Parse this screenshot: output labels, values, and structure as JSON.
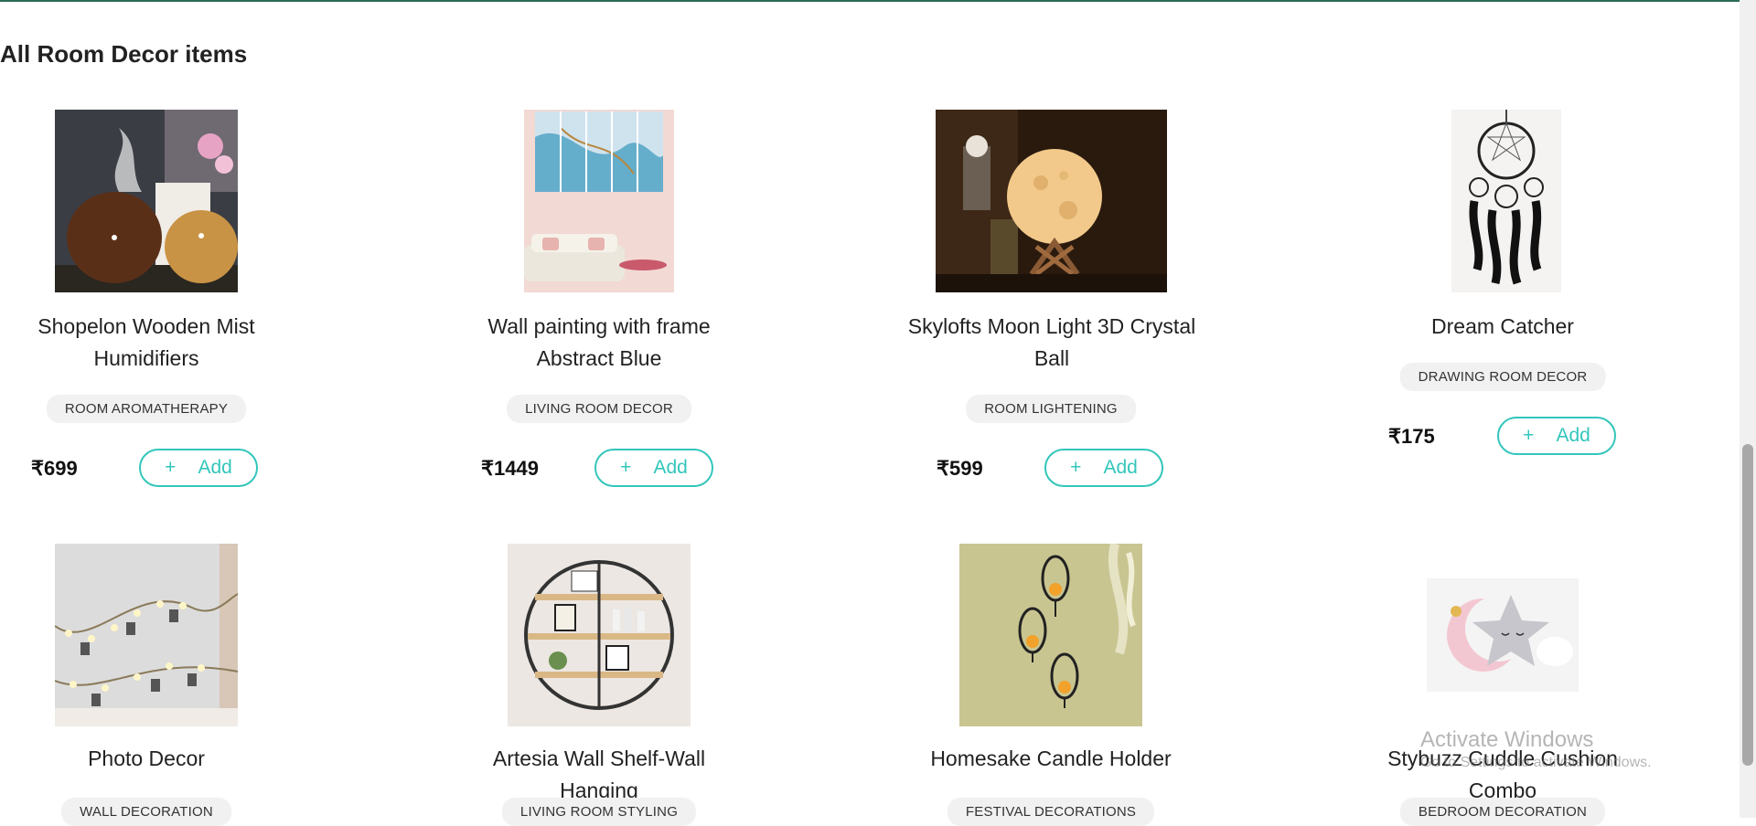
{
  "page": {
    "heading": "All Room Decor items"
  },
  "products": [
    {
      "title": "Shopelon Wooden Mist Humidifiers",
      "title_line1": "Shopelon Wooden Mist",
      "title_line2": "Humidifiers",
      "category": "ROOM AROMATHERAPY",
      "price": "₹699",
      "add_label": "Add",
      "image_icon": "humidifier-image"
    },
    {
      "title": "Wall painting with frame Abstract Blue",
      "title_line1": "Wall painting with frame",
      "title_line2": "Abstract Blue",
      "category": "LIVING ROOM DECOR",
      "price": "₹1449",
      "add_label": "Add",
      "image_icon": "wall-painting-image"
    },
    {
      "title": "Skylofts Moon Light 3D Crystal Ball",
      "title_line1": "Skylofts Moon Light 3D Crystal",
      "title_line2": "Ball",
      "category": "ROOM LIGHTENING",
      "price": "₹599",
      "add_label": "Add",
      "image_icon": "moon-lamp-image"
    },
    {
      "title": "Dream Catcher",
      "title_line1": "Dream Catcher",
      "title_line2": "",
      "category": "DRAWING ROOM DECOR",
      "price": "₹175",
      "add_label": "Add",
      "image_icon": "dream-catcher-image"
    },
    {
      "title": "Photo Decor",
      "category": "WALL DECORATION",
      "image_icon": "photo-lights-image"
    },
    {
      "title": "Artesia Wall Shelf-Wall Hanging",
      "category": "LIVING ROOM STYLING",
      "image_icon": "round-shelf-image"
    },
    {
      "title": "Homesake Candle Holder",
      "category": "FESTIVAL DECORATIONS",
      "image_icon": "candle-holder-image"
    },
    {
      "title": "Stybuzz Cuddle Cushion Combo",
      "category": "BEDROOM DECORATION",
      "image_icon": "cushion-image"
    }
  ],
  "watermark": {
    "line1": "Activate Windows",
    "line2": "Go to Settings to activate Windows."
  },
  "colors": {
    "accent": "#33c6bb",
    "top_border": "#2b6b57",
    "badge_bg": "#f1f1f1"
  }
}
